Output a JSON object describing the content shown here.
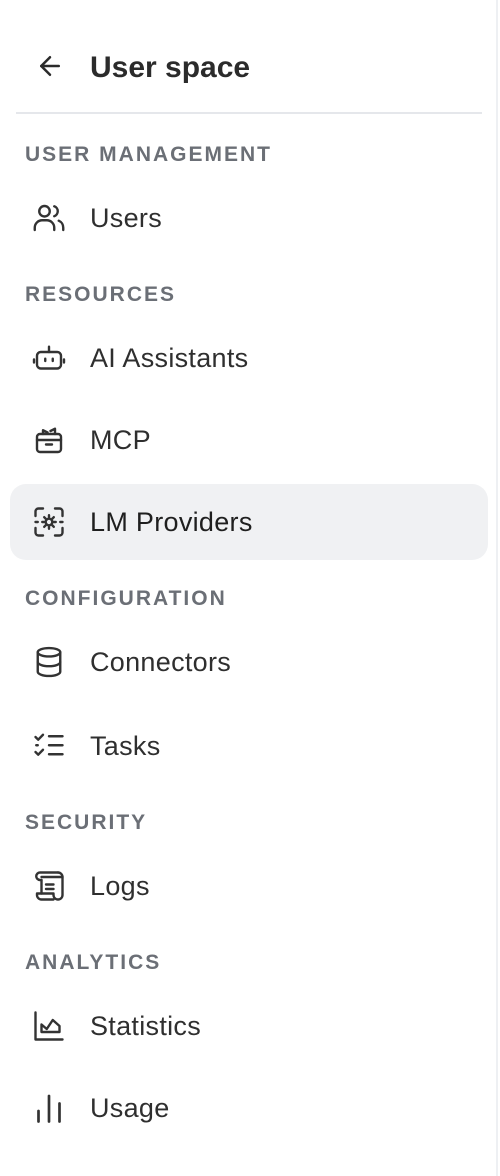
{
  "header": {
    "title": "User space"
  },
  "sections": {
    "user_management": {
      "label": "USER MANAGEMENT",
      "items": {
        "users": {
          "label": "Users",
          "icon": "users-icon"
        }
      }
    },
    "resources": {
      "label": "RESOURCES",
      "items": {
        "ai_assistants": {
          "label": "AI Assistants",
          "icon": "robot-icon"
        },
        "mcp": {
          "label": "MCP",
          "icon": "toolbox-icon"
        },
        "lm_providers": {
          "label": "LM Providers",
          "icon": "cpu-gear-icon",
          "active": true
        }
      }
    },
    "configuration": {
      "label": "CONFIGURATION",
      "items": {
        "connectors": {
          "label": "Connectors",
          "icon": "database-icon"
        },
        "tasks": {
          "label": "Tasks",
          "icon": "checklist-icon"
        }
      }
    },
    "security": {
      "label": "SECURITY",
      "items": {
        "logs": {
          "label": "Logs",
          "icon": "scroll-icon"
        }
      }
    },
    "analytics": {
      "label": "ANALYTICS",
      "items": {
        "statistics": {
          "label": "Statistics",
          "icon": "area-chart-icon"
        },
        "usage": {
          "label": "Usage",
          "icon": "bar-chart-icon"
        }
      }
    }
  },
  "colors": {
    "active_background": "#f0f1f3",
    "section_label": "#6b6f76",
    "text": "#2f2f2f",
    "divider": "#e5e7eb"
  }
}
